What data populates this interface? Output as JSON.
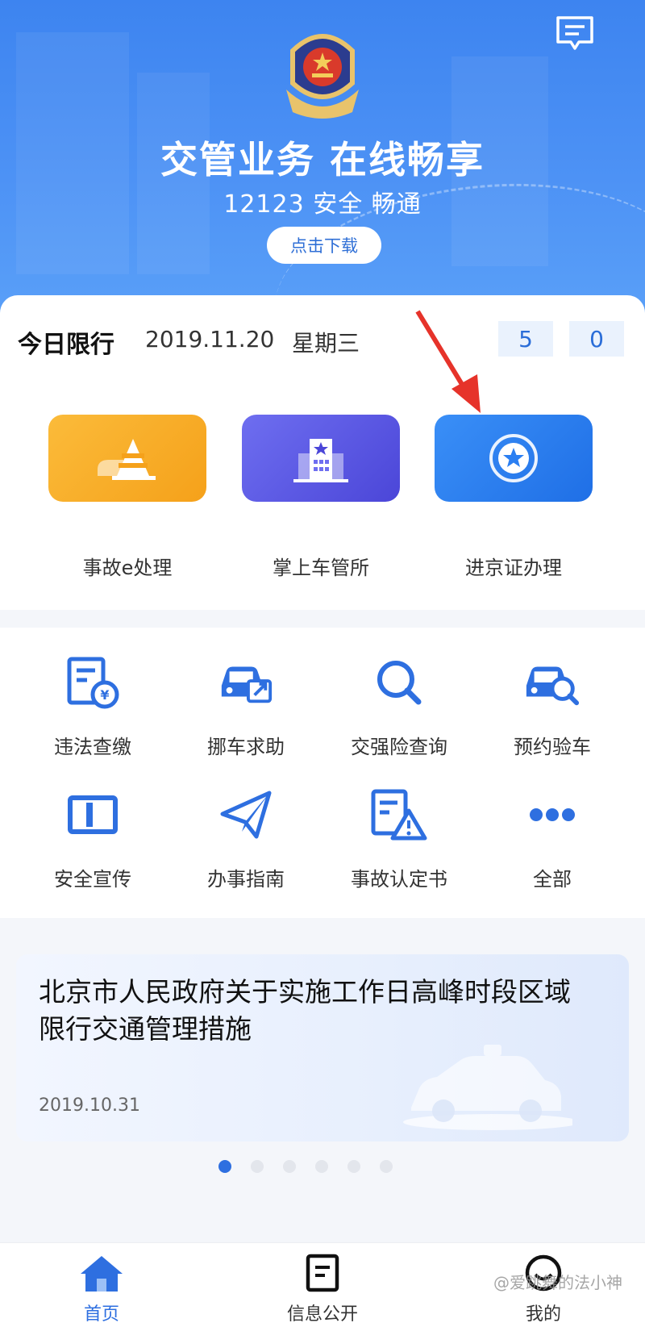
{
  "hero": {
    "title": "交管业务 在线畅享",
    "subtitle": "12123 安全 畅通",
    "download_label": "点击下载",
    "message_icon": "message-icon",
    "emblem_icon": "police-emblem-icon"
  },
  "restriction": {
    "label": "今日限行",
    "date": "2019.11.20",
    "weekday": "星期三",
    "numbers": [
      "5",
      "0"
    ]
  },
  "features": [
    {
      "label": "事故e处理",
      "icon": "traffic-cone-icon",
      "color": "#f7a824"
    },
    {
      "label": "掌上车管所",
      "icon": "building-icon",
      "color": "#5b59e0"
    },
    {
      "label": "进京证办理",
      "icon": "star-badge-icon",
      "color": "#2b7ff2"
    }
  ],
  "services": [
    {
      "label": "违法查缴",
      "icon": "fine-document-icon"
    },
    {
      "label": "挪车求助",
      "icon": "car-move-icon"
    },
    {
      "label": "交强险查询",
      "icon": "search-icon"
    },
    {
      "label": "预约验车",
      "icon": "car-inspect-icon"
    },
    {
      "label": "安全宣传",
      "icon": "book-icon"
    },
    {
      "label": "办事指南",
      "icon": "paper-plane-icon"
    },
    {
      "label": "事故认定书",
      "icon": "warning-document-icon"
    },
    {
      "label": "全部",
      "icon": "more-dots-icon"
    }
  ],
  "news": {
    "title": "北京市人民政府关于实施工作日高峰时段区域限行交通管理措施",
    "date": "2019.10.31",
    "page_count": 6,
    "active_page": 1
  },
  "tabs": [
    {
      "label": "首页",
      "icon": "home-icon",
      "active": true
    },
    {
      "label": "信息公开",
      "icon": "document-icon",
      "active": false
    },
    {
      "label": "我的",
      "icon": "smile-icon",
      "active": false
    }
  ],
  "watermark": "@爱跳舞的法小神",
  "colors": {
    "primary": "#2e6fe0",
    "hero": "#4d92f5"
  }
}
